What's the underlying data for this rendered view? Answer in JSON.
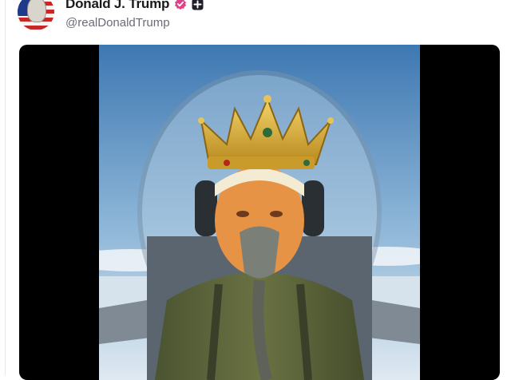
{
  "post": {
    "author": {
      "display_name": "Donald J. Trump",
      "handle": "@realDonaldTrump",
      "avatar_icon": "flag-portrait-avatar",
      "verified_icon": "verified-badge-icon",
      "verified_color": "#e0428a",
      "extra_icon": "plus-box-icon"
    },
    "media": {
      "kind": "video-still",
      "background": "#000000"
    }
  }
}
